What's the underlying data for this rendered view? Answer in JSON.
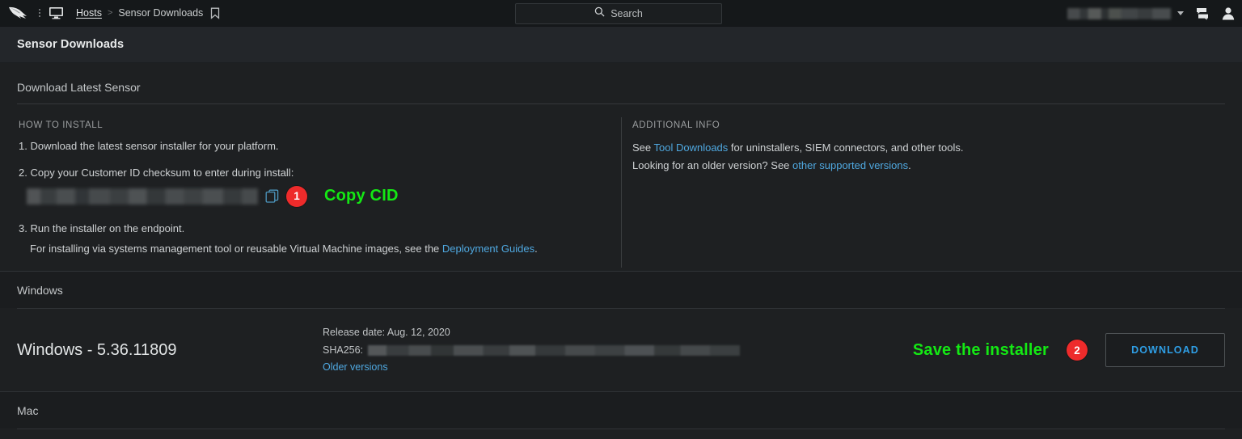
{
  "appbar": {
    "logo_icon": "falcon-logo",
    "menu_icon": "kebab-menu-icon",
    "monitor_icon": "monitor-icon",
    "breadcrumb": {
      "root": "Hosts",
      "separator": ">",
      "current": "Sensor Downloads",
      "bookmark_icon": "bookmark-icon"
    },
    "search": {
      "placeholder": "Search",
      "icon": "search-icon"
    },
    "account": {
      "redacted": true,
      "chevron_icon": "chevron-down-icon"
    },
    "support_icon": "support-icon",
    "user_icon": "user-avatar-icon"
  },
  "page": {
    "title": "Sensor Downloads"
  },
  "download_latest": {
    "heading": "Download Latest Sensor",
    "how_to_install": {
      "eyebrow": "HOW TO INSTALL",
      "step1": "1. Download the latest sensor installer for your platform.",
      "step2": "2. Copy your Customer ID checksum to enter during install:",
      "cid_redacted": true,
      "copy_icon": "copy-icon",
      "step3": "3. Run the installer on the endpoint.",
      "step3_sub_pre": "For installing via systems management tool or reusable Virtual Machine images, see the ",
      "step3_sub_link": "Deployment Guides",
      "step3_sub_post": "."
    },
    "additional_info": {
      "eyebrow": "ADDITIONAL INFO",
      "line1_pre": "See ",
      "line1_link": "Tool Downloads",
      "line1_post": " for uninstallers, SIEM connectors, and other tools.",
      "line2_pre": "Looking for an older version? See ",
      "line2_link": "other supported versions",
      "line2_post": "."
    }
  },
  "annotations": {
    "badge1": "1",
    "label1": "Copy CID",
    "badge2": "2",
    "label2": "Save the installer",
    "badge_color": "#ee2b2b",
    "label_color": "#14e814"
  },
  "platforms": [
    {
      "name": "Windows",
      "release": {
        "title": "Windows - 5.36.11809",
        "release_date_label": "Release date: Aug. 12, 2020",
        "sha_label": "SHA256:",
        "sha_redacted": true,
        "older_versions_link": "Older versions",
        "download_label": "DOWNLOAD"
      }
    },
    {
      "name": "Mac"
    }
  ]
}
